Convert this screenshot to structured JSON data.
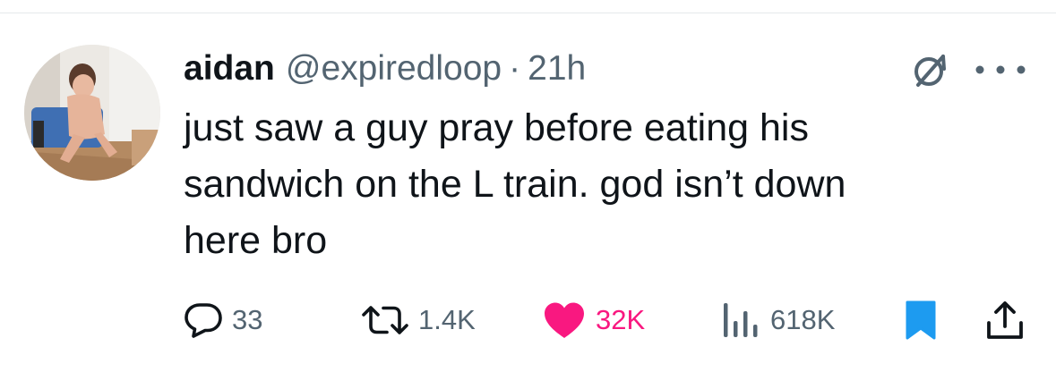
{
  "tweet": {
    "display_name": "aidan",
    "handle": "@expiredloop",
    "separator": "·",
    "time": "21h",
    "text": "just saw a guy pray before eating his\nsandwich on the L train. god isn’t down\nhere bro",
    "avatar_description": "avatar-photo"
  },
  "actions": {
    "replies": "33",
    "reposts": "1.4K",
    "likes": "32K",
    "views": "618K"
  },
  "colors": {
    "text_primary": "#0f1419",
    "text_secondary": "#536471",
    "like_pink": "#f91880",
    "bookmark_blue": "#1d9bf0",
    "divider": "#e6e9eb"
  },
  "icons": {
    "reply": "speech-bubble-icon",
    "repost": "repost-arrows-icon",
    "like": "heart-filled-icon",
    "views": "bar-chart-icon",
    "bookmark": "bookmark-filled-icon",
    "share": "share-upload-icon",
    "grok": "grok-slash-icon",
    "more": "more-dots-icon"
  }
}
